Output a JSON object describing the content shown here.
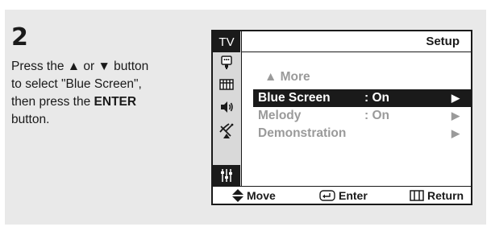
{
  "instruction": {
    "step_number": "2",
    "line1_prefix": "Press the ",
    "up_glyph": "▲",
    "or_text": " or ",
    "down_glyph": "▼",
    "line1_suffix": " button",
    "line2": "to select \"Blue Screen\",",
    "line3_prefix": "then press the ",
    "enter_word": "ENTER",
    "line4": "button."
  },
  "osd": {
    "tv_label": "TV",
    "menu_title": "Setup",
    "sidebar_icons": [
      {
        "name": "input-icon"
      },
      {
        "name": "picture-icon"
      },
      {
        "name": "sound-icon"
      },
      {
        "name": "channel-icon"
      },
      {
        "name": "setup-icon",
        "active": true
      }
    ],
    "more_label": "▲ More",
    "rows": [
      {
        "label": "Blue Screen",
        "value": ": On",
        "arrow": "▶",
        "selected": true
      },
      {
        "label": "Melody",
        "value": ": On",
        "arrow": "▶",
        "selected": false
      },
      {
        "label": "Demonstration",
        "value": "",
        "arrow": "▶",
        "selected": false
      }
    ],
    "footer": {
      "move_label": "Move",
      "enter_label": "Enter",
      "return_label": "Return"
    }
  },
  "colors": {
    "panel_bg": "#e9e9e9",
    "osd_dark": "#1a1a1a",
    "osd_disabled_text": "#9a9a9a",
    "sidebar_bg": "#d9d9d9"
  }
}
